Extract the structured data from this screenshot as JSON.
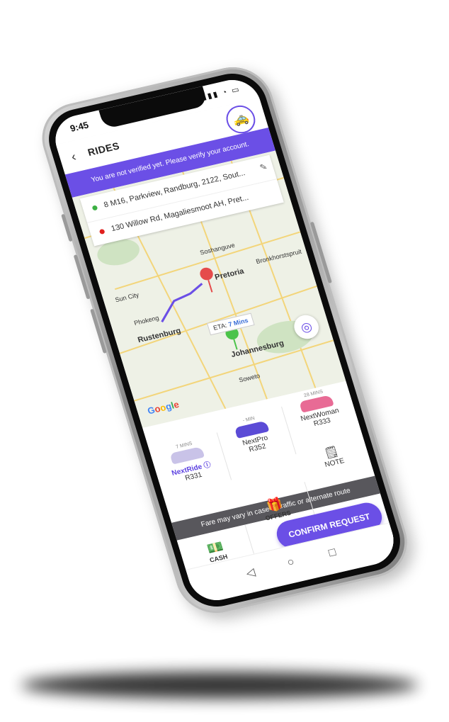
{
  "status": {
    "time": "9:45",
    "icons": "▮▮▮ ◔ ▭"
  },
  "header": {
    "title": "RIDES",
    "back_icon": "‹"
  },
  "verify_banner": "You are not verified yet. Please verify your account.",
  "addresses": {
    "pickup": "8 M16, Parkview, Randburg, 2122, Sout...",
    "dropoff": "130 Willow Rd, Magaliesmoot AH, Pret..."
  },
  "map": {
    "labels": [
      "Soshanguve",
      "Pretoria",
      "Bronkhorstspruit",
      "Sun City",
      "Phokeng",
      "Rustenburg",
      "Johannesburg",
      "Soweto"
    ],
    "eta_prefix": "ETA: ",
    "eta_value": "7 Mins",
    "google": [
      "G",
      "o",
      "o",
      "g",
      "l",
      "e"
    ]
  },
  "rides": [
    {
      "mins": "7 MINS",
      "name": "NextRide ⓘ",
      "price": "R331",
      "color": "#c9c3e8"
    },
    {
      "mins": "- MIN",
      "name": "NextPro",
      "price": "R352",
      "color": "#5b4bd6"
    },
    {
      "mins": "28 MINS",
      "name": "NextWoman",
      "price": "R333",
      "color": "#e86b95"
    }
  ],
  "note_label": "NOTE",
  "fare_notice": "Fare may vary in case of traffic or alternate route",
  "options": {
    "cash": "CASH",
    "offers": "OFFERS"
  },
  "confirm_label": "CONFIRM REQUEST",
  "nav": {
    "back": "◁",
    "home": "○",
    "recent": "□"
  },
  "colors": {
    "accent": "#6b4fe6",
    "band": "#58575c"
  }
}
